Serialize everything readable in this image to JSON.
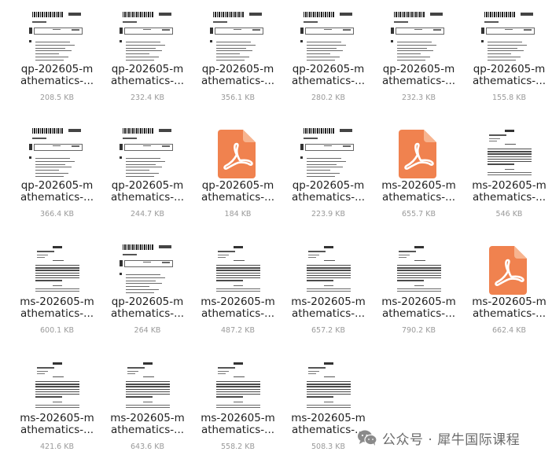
{
  "files": [
    {
      "name_line1": "qp-202605-m",
      "name_line2": "athematics-...",
      "size": "208.5 KB",
      "thumb": "qp"
    },
    {
      "name_line1": "qp-202605-m",
      "name_line2": "athematics-...",
      "size": "232.4 KB",
      "thumb": "qp"
    },
    {
      "name_line1": "qp-202605-m",
      "name_line2": "athematics-...",
      "size": "356.1 KB",
      "thumb": "qp"
    },
    {
      "name_line1": "qp-202605-m",
      "name_line2": "athematics-...",
      "size": "280.2 KB",
      "thumb": "qp"
    },
    {
      "name_line1": "qp-202605-m",
      "name_line2": "athematics-...",
      "size": "232.3 KB",
      "thumb": "qp"
    },
    {
      "name_line1": "qp-202605-m",
      "name_line2": "athematics-...",
      "size": "155.8 KB",
      "thumb": "qp"
    },
    {
      "name_line1": "qp-202605-m",
      "name_line2": "athematics-...",
      "size": "366.4 KB",
      "thumb": "qp"
    },
    {
      "name_line1": "qp-202605-m",
      "name_line2": "athematics-...",
      "size": "244.7 KB",
      "thumb": "qp"
    },
    {
      "name_line1": "qp-202605-m",
      "name_line2": "athematics-...",
      "size": "184 KB",
      "thumb": "pdf"
    },
    {
      "name_line1": "qp-202605-m",
      "name_line2": "athematics-...",
      "size": "223.9 KB",
      "thumb": "qp"
    },
    {
      "name_line1": "ms-202605-m",
      "name_line2": "athematics-...",
      "size": "655.7 KB",
      "thumb": "pdf"
    },
    {
      "name_line1": "ms-202605-m",
      "name_line2": "athematics-...",
      "size": "546 KB",
      "thumb": "ms"
    },
    {
      "name_line1": "ms-202605-m",
      "name_line2": "athematics-...",
      "size": "600.1 KB",
      "thumb": "ms"
    },
    {
      "name_line1": "qp-202605-m",
      "name_line2": "athematics-...",
      "size": "264 KB",
      "thumb": "qp"
    },
    {
      "name_line1": "ms-202605-m",
      "name_line2": "athematics-...",
      "size": "487.2 KB",
      "thumb": "ms"
    },
    {
      "name_line1": "ms-202605-m",
      "name_line2": "athematics-...",
      "size": "657.2 KB",
      "thumb": "ms"
    },
    {
      "name_line1": "ms-202605-m",
      "name_line2": "athematics-...",
      "size": "790.2 KB",
      "thumb": "ms"
    },
    {
      "name_line1": "ms-202605-m",
      "name_line2": "athematics-...",
      "size": "662.4 KB",
      "thumb": "pdf"
    },
    {
      "name_line1": "ms-202605-m",
      "name_line2": "athematics-...",
      "size": "421.6 KB",
      "thumb": "ms"
    },
    {
      "name_line1": "ms-202605-m",
      "name_line2": "athematics-...",
      "size": "643.6 KB",
      "thumb": "ms"
    },
    {
      "name_line1": "ms-202605-m",
      "name_line2": "athematics-...",
      "size": "558.2 KB",
      "thumb": "ms"
    },
    {
      "name_line1": "ms-202605-m",
      "name_line2": "athematics-...",
      "size": "508.3 KB",
      "thumb": "ms"
    }
  ],
  "watermark": {
    "text": "公众号 · 犀牛国际课程",
    "icon": "wechat-icon"
  },
  "colors": {
    "pdf_icon": "#f0824f",
    "pdf_fold": "#f7b48f",
    "name_text": "#1f1f1f",
    "size_text": "#9a9a9a"
  }
}
